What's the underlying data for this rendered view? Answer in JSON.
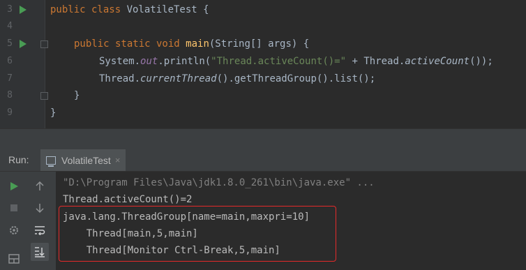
{
  "editor": {
    "lines": [
      {
        "num": "3",
        "run": true
      },
      {
        "num": "4"
      },
      {
        "num": "5",
        "run": true,
        "fold": true
      },
      {
        "num": "6"
      },
      {
        "num": "7"
      },
      {
        "num": "8",
        "fold": true
      },
      {
        "num": "9"
      }
    ],
    "code": {
      "l3_kw": "public class ",
      "l3_name": "VolatileTest {",
      "l5_kw": "public static void ",
      "l5_fn": "main",
      "l5_rest": "(String[] args) {",
      "l6_a": "System.",
      "l6_out": "out",
      "l6_b": ".println(",
      "l6_str": "\"Thread.activeCount()=\"",
      "l6_c": " + Thread.",
      "l6_method": "activeCount",
      "l6_d": "());",
      "l7_a": "Thread.",
      "l7_method": "currentThread",
      "l7_b": "().getThreadGroup().list();",
      "l8": "}",
      "l9": "}"
    }
  },
  "run_panel": {
    "label": "Run:",
    "tab_label": "VolatileTest",
    "tab_close": "×"
  },
  "console": {
    "command": "\"D:\\Program Files\\Java\\jdk1.8.0_261\\bin\\java.exe\" ...",
    "lines": [
      "Thread.activeCount()=2",
      "java.lang.ThreadGroup[name=main,maxpri=10]",
      "    Thread[main,5,main]",
      "    Thread[Monitor Ctrl-Break,5,main]"
    ]
  },
  "colors": {
    "keyword": "#cc7832",
    "string": "#6a8759",
    "static_field": "#9876aa",
    "method_decl": "#ffc66d",
    "highlight_box": "#e52a2a",
    "run_green": "#499c54"
  },
  "icons": [
    "run-icon",
    "stop-icon",
    "scroll-up-icon",
    "scroll-down-icon",
    "soft-wrap-icon",
    "scroll-to-end-icon",
    "settings-icon",
    "layout-icon"
  ]
}
